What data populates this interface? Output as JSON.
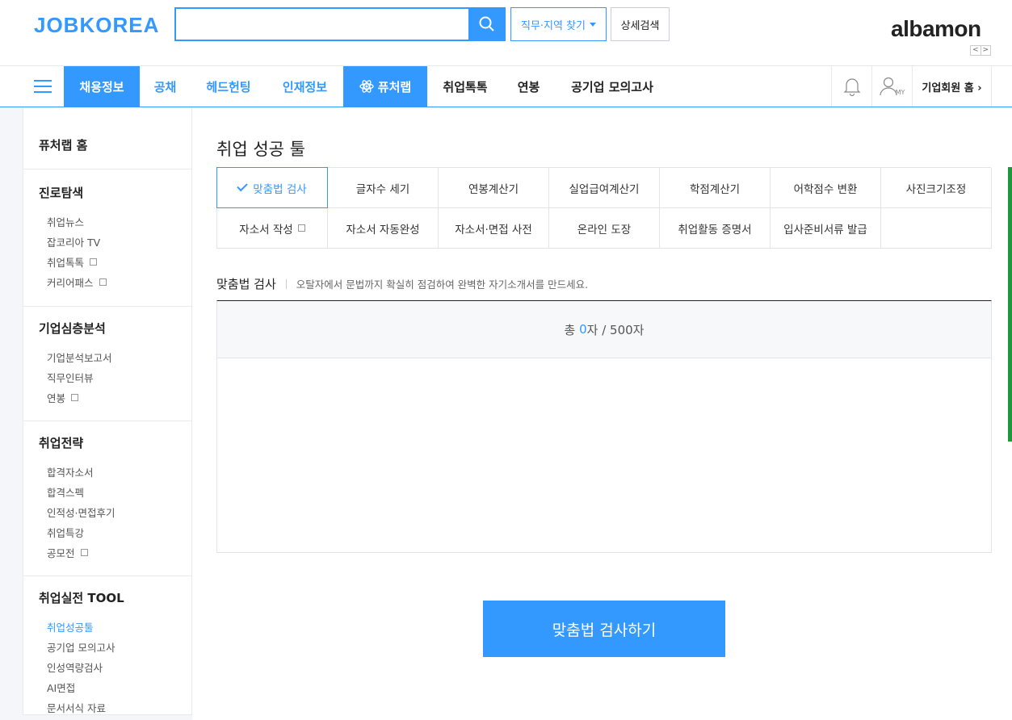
{
  "header": {
    "logo": "JOBKOREA",
    "search_placeholder": "",
    "job_region_label": "직무·지역 찾기",
    "detail_search_label": "상세검색",
    "albamon_logo": "albamon",
    "albamon_prev": "<",
    "albamon_next": ">"
  },
  "gnb": {
    "items": [
      {
        "label": "채용정보"
      },
      {
        "label": "공채"
      },
      {
        "label": "헤드헌팅"
      },
      {
        "label": "인재정보"
      },
      {
        "label": "퓨처랩"
      },
      {
        "label": "취업톡톡"
      },
      {
        "label": "연봉"
      },
      {
        "label": "공기업 모의고사"
      }
    ],
    "corp_home_label": "기업회원 홈 ›",
    "my_label": "MY"
  },
  "lnb": {
    "home": "퓨처랩 홈",
    "groups": [
      {
        "title": "진로탐색",
        "items": [
          "취업뉴스",
          "잡코리아 TV",
          "취업톡톡",
          "커리어패스"
        ]
      },
      {
        "title": "기업심층분석",
        "items": [
          "기업분석보고서",
          "직무인터뷰",
          "연봉"
        ]
      },
      {
        "title": "취업전략",
        "items": [
          "합격자소서",
          "합격스펙",
          "인적성·면접후기",
          "취업특강",
          "공모전"
        ]
      },
      {
        "title": "취업실전 TOOL",
        "items": [
          "취업성공툴",
          "공기업 모의고사",
          "인성역량검사",
          "AI면접",
          "문서서식 자료"
        ]
      }
    ]
  },
  "content": {
    "page_title": "취업 성공 툴",
    "tools_row1": [
      "맞춤법 검사",
      "글자수 세기",
      "연봉계산기",
      "실업급여계산기",
      "학점계산기",
      "어학점수 변환",
      "사진크기조정"
    ],
    "tools_row2": [
      "자소서 작성",
      "자소서 자동완성",
      "자소서·면접 사전",
      "온라인 도장",
      "취업활동 증명서",
      "입사준비서류 발급",
      ""
    ],
    "section_title": "맞춤법 검사",
    "section_desc": "오탈자에서 문법까지 확실히 점검하여 완벽한 자기소개서를 만드세요.",
    "counter_prefix": "총 ",
    "counter_current": "0",
    "counter_suffix": "자 / 500자",
    "editor_value": "",
    "submit_label": "맞춤법 검사하기"
  },
  "colors": {
    "brand": "#3399ff",
    "scroll_indicator": "#1a9a3a"
  }
}
